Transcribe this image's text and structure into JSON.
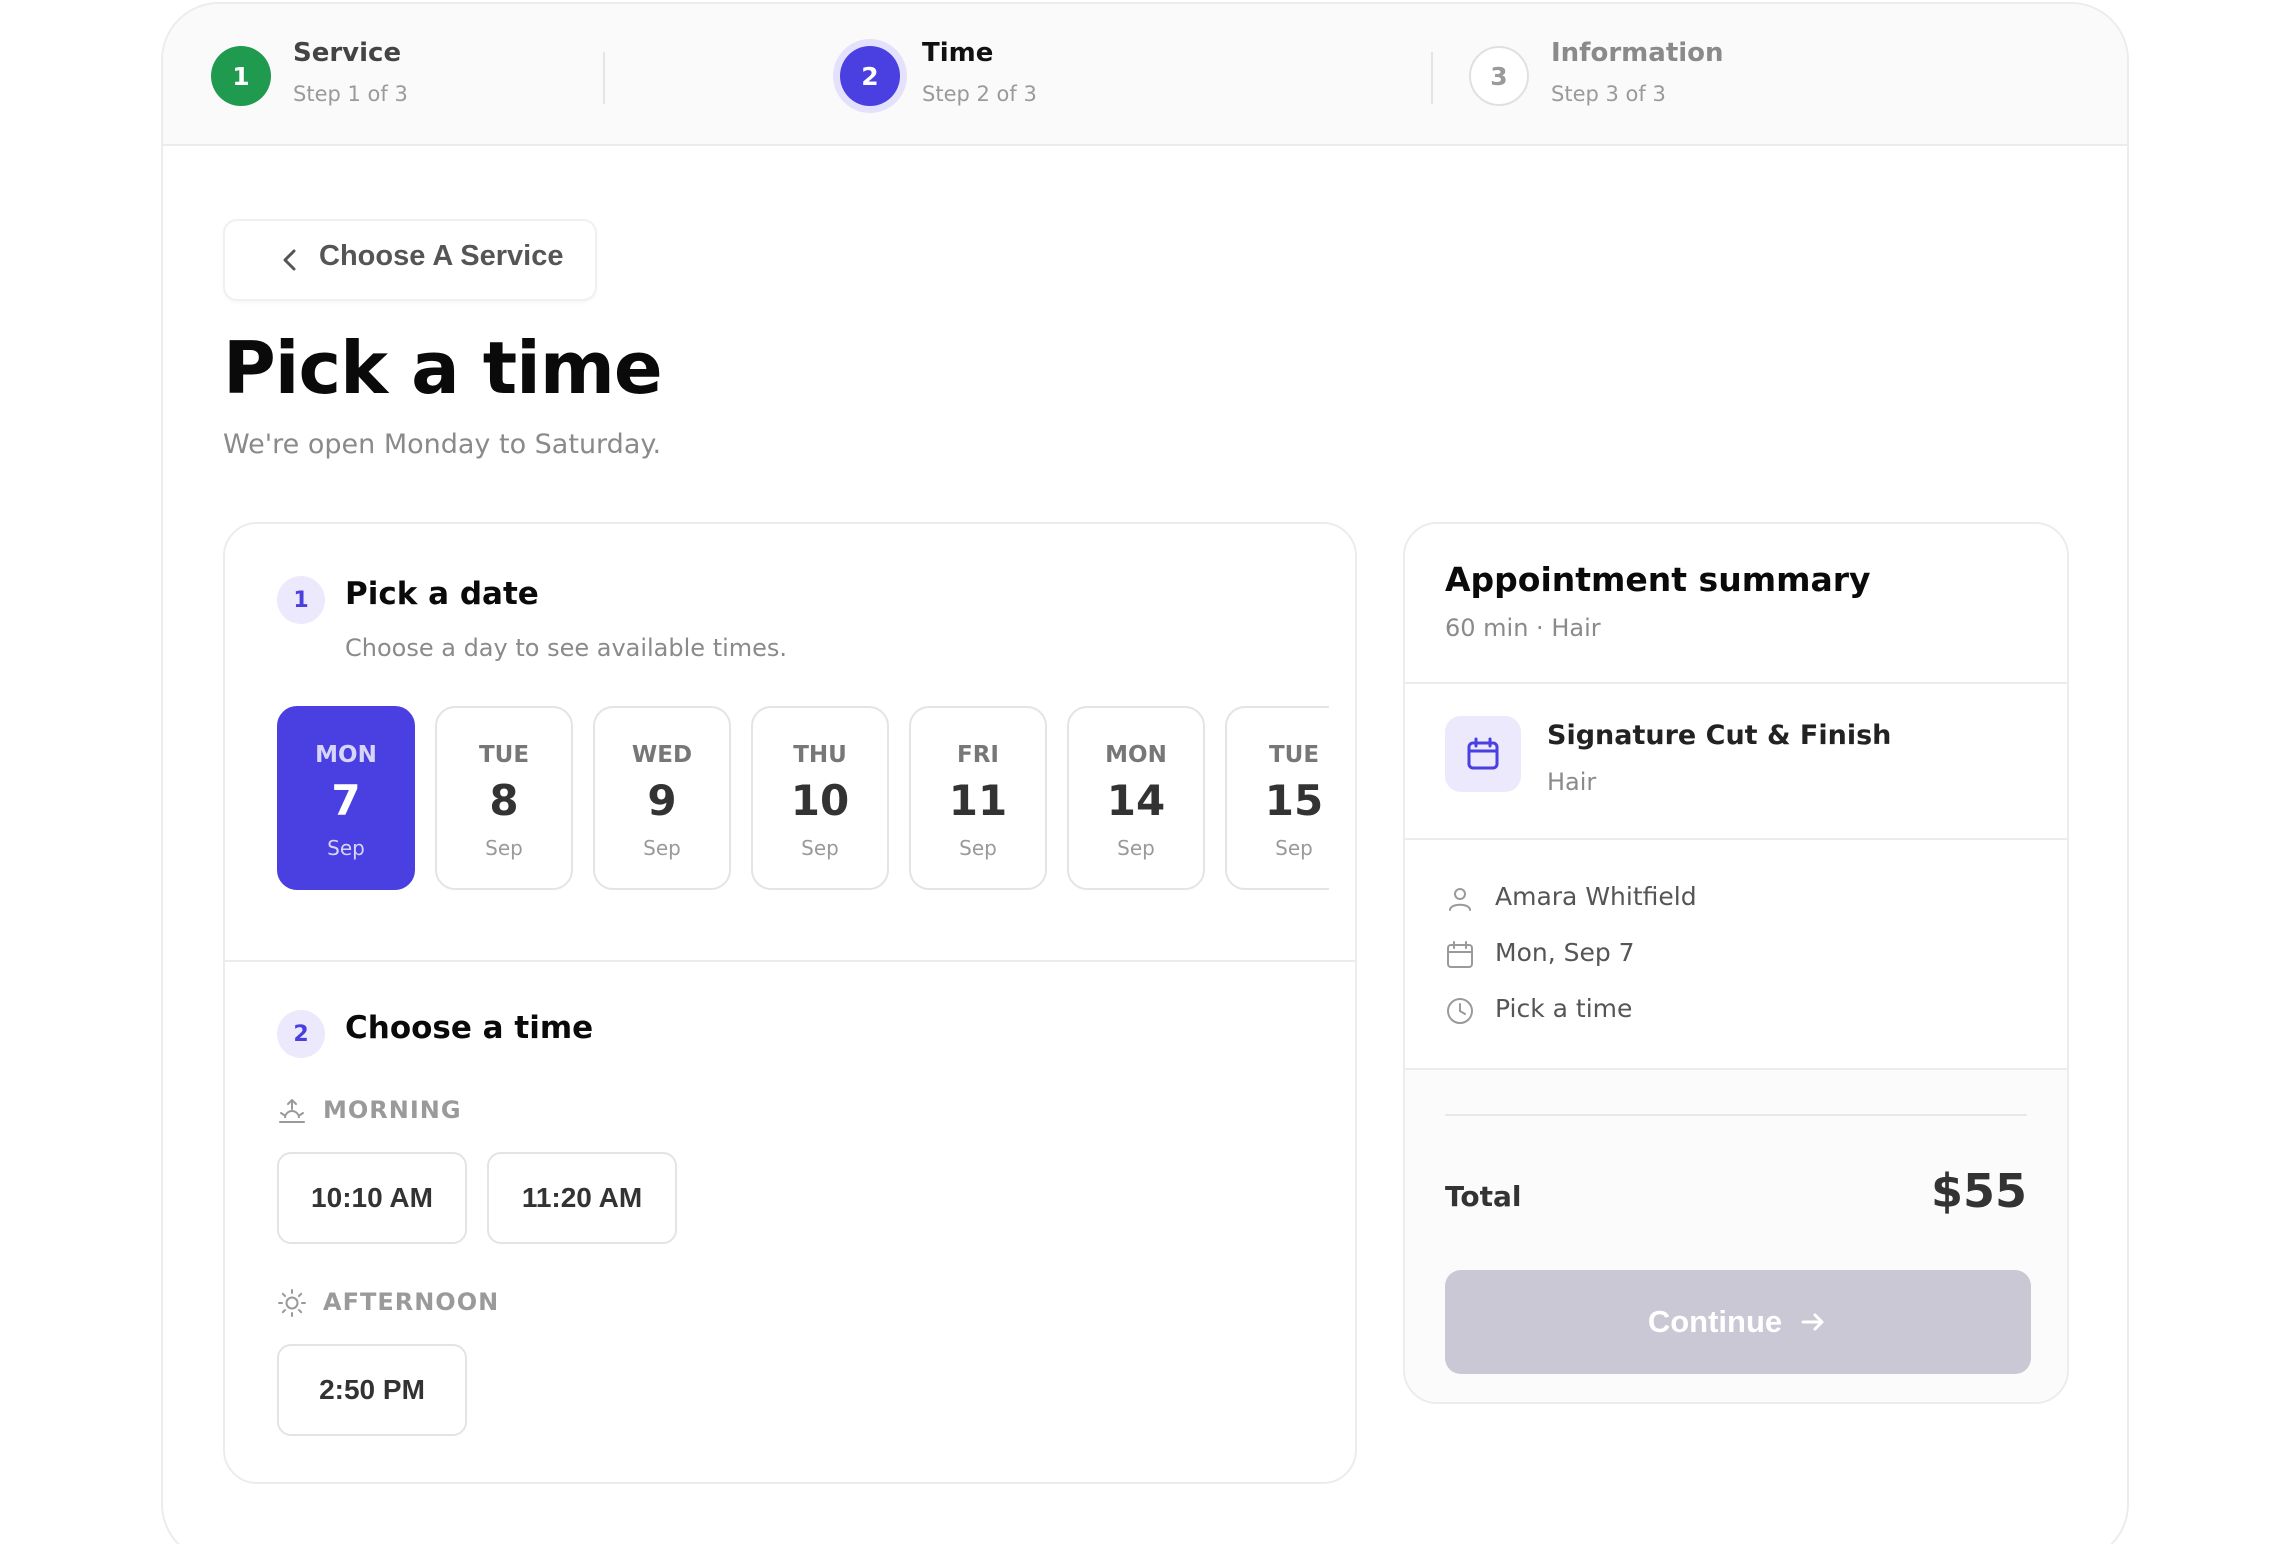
{
  "stepper": {
    "steps": [
      {
        "number": "1",
        "label": "Service",
        "sub": "Step 1 of 3",
        "state": "complete"
      },
      {
        "number": "2",
        "label": "Time",
        "sub": "Step 2 of 3",
        "state": "active"
      },
      {
        "number": "3",
        "label": "Information",
        "sub": "Step 3 of 3",
        "state": "upcoming"
      }
    ]
  },
  "back_button": {
    "label": "Choose A Service",
    "icon": "chevron-left-icon"
  },
  "page": {
    "title": "Pick a time",
    "subtitle": "We're open Monday to Saturday."
  },
  "date_section": {
    "number": "1",
    "title": "Pick a date",
    "subtitle": "Choose a day to see available times.",
    "dates": [
      {
        "dow": "MON",
        "day": "7",
        "month": "Sep",
        "selected": true
      },
      {
        "dow": "TUE",
        "day": "8",
        "month": "Sep",
        "selected": false
      },
      {
        "dow": "WED",
        "day": "9",
        "month": "Sep",
        "selected": false
      },
      {
        "dow": "THU",
        "day": "10",
        "month": "Sep",
        "selected": false
      },
      {
        "dow": "FRI",
        "day": "11",
        "month": "Sep",
        "selected": false
      },
      {
        "dow": "MON",
        "day": "14",
        "month": "Sep",
        "selected": false
      },
      {
        "dow": "TUE",
        "day": "15",
        "month": "Sep",
        "selected": false
      }
    ]
  },
  "time_section": {
    "number": "2",
    "title": "Choose a time",
    "morning": {
      "label": "MORNING",
      "icon": "sunrise-icon",
      "slots": [
        "10:10 AM",
        "11:20 AM"
      ]
    },
    "afternoon": {
      "label": "AFTERNOON",
      "icon": "sun-icon",
      "slots": [
        "2:50 PM"
      ]
    }
  },
  "summary": {
    "title": "Appointment summary",
    "subtitle": "60 min · Hair",
    "service_name": "Signature Cut & Finish",
    "service_category": "Hair",
    "staff": "Amara Whitfield",
    "date": "Mon, Sep 7",
    "time": "Pick a time",
    "total_label": "Total",
    "total_value": "$55",
    "continue_label": "Continue"
  },
  "colors": {
    "accent": "#4a3fe0",
    "success": "#1f9a4f",
    "accent_soft": "#ebe9fb",
    "disabled_button": "#c9c8d4"
  }
}
